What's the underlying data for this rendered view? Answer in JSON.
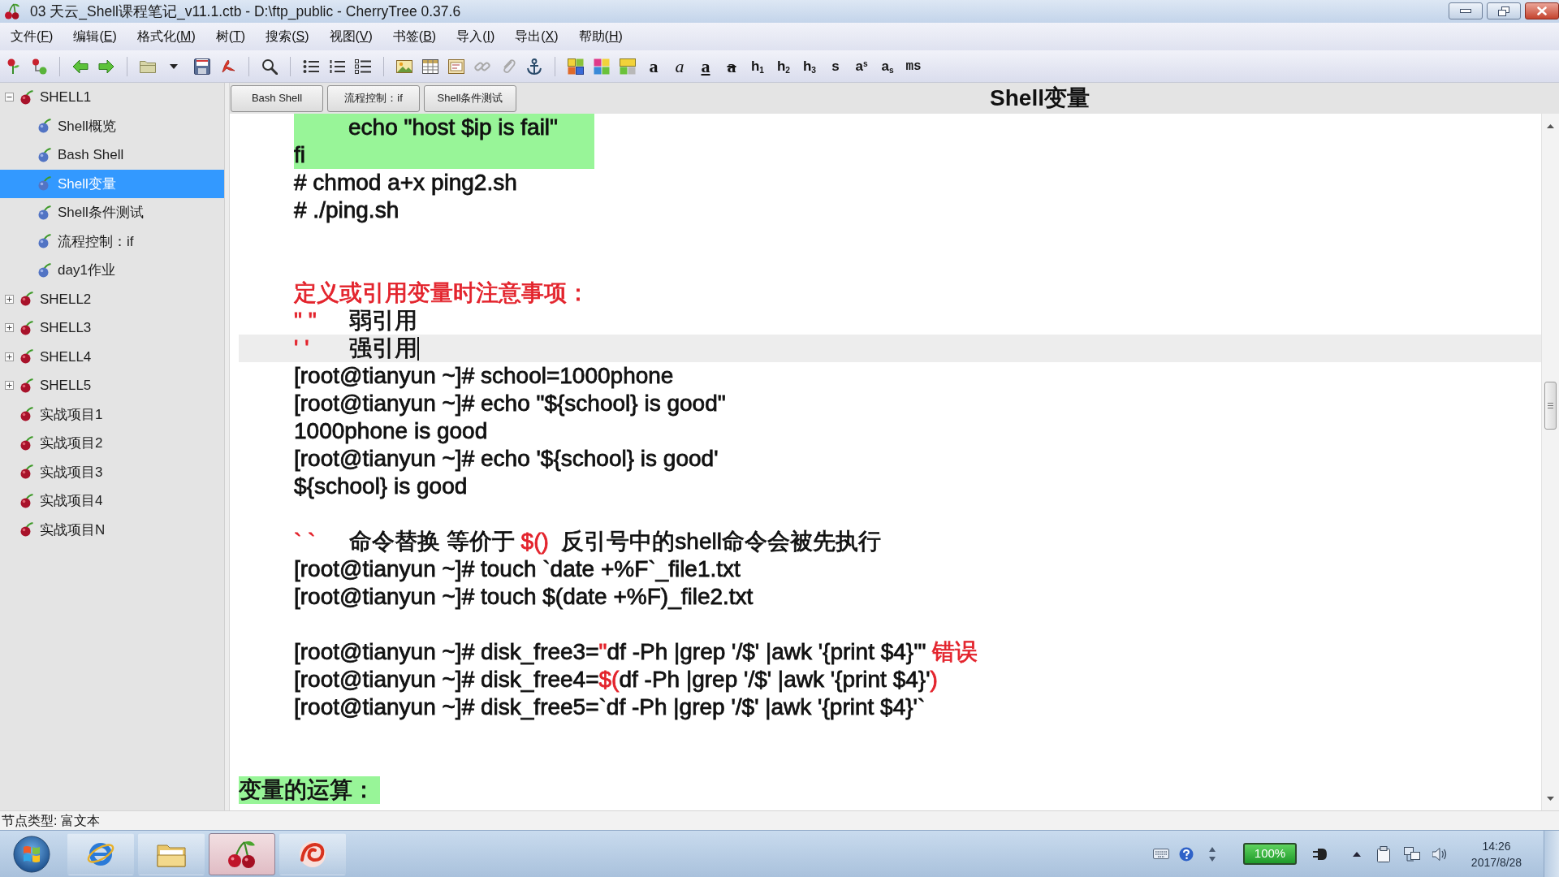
{
  "window": {
    "title": "03 天云_Shell课程笔记_v11.1.ctb - D:\\ftp_public - CherryTree 0.37.6"
  },
  "menu": [
    "文件(F)",
    "编辑(E)",
    "格式化(M)",
    "树(T)",
    "搜索(S)",
    "视图(V)",
    "书签(B)",
    "导入(I)",
    "导出(X)",
    "帮助(H)"
  ],
  "toolbar": {
    "format_buttons": [
      {
        "label": "a",
        "kind": "bold"
      },
      {
        "label": "a",
        "kind": "italic"
      },
      {
        "label": "a",
        "kind": "underline"
      },
      {
        "label": "a",
        "kind": "strike"
      },
      {
        "label": "h$_{1}$",
        "kind": "heading"
      },
      {
        "label": "h$_{2}$",
        "kind": "heading"
      },
      {
        "label": "h$_{3}$",
        "kind": "heading"
      },
      {
        "label": "s",
        "kind": "small"
      },
      {
        "label": "a$^{s}$",
        "kind": "raised"
      },
      {
        "label": "a$_{s}$",
        "kind": "lowered"
      },
      {
        "label": "ms",
        "kind": "mono"
      }
    ]
  },
  "tree": {
    "nodes": [
      {
        "label": "SHELL1",
        "expanded": true,
        "selected": false,
        "children": [
          {
            "label": "Shell概览",
            "selected": false
          },
          {
            "label": "Bash Shell",
            "selected": false
          },
          {
            "label": "Shell变量",
            "selected": true
          },
          {
            "label": "Shell条件测试",
            "selected": false
          },
          {
            "label": "流程控制：if",
            "selected": false
          },
          {
            "label": "day1作业",
            "selected": false
          }
        ]
      },
      {
        "label": "SHELL2",
        "expanded": false,
        "selected": false
      },
      {
        "label": "SHELL3",
        "expanded": false,
        "selected": false
      },
      {
        "label": "SHELL4",
        "expanded": false,
        "selected": false
      },
      {
        "label": "SHELL5",
        "expanded": false,
        "selected": false
      },
      {
        "label": "实战项目1",
        "selected": false
      },
      {
        "label": "实战项目2",
        "selected": false
      },
      {
        "label": "实战项目3",
        "selected": false
      },
      {
        "label": "实战项目4",
        "selected": false
      },
      {
        "label": "实战项目N",
        "selected": false
      }
    ]
  },
  "content": {
    "recent_nodes": [
      "Bash Shell",
      "流程控制：if",
      "Shell条件测试"
    ],
    "title": "Shell变量",
    "lines": [
      {
        "kind": "marked_inner",
        "current": false,
        "segments": [
          {
            "text": "echo \"host $ip is fail\"",
            "color": "#111111"
          }
        ]
      },
      {
        "kind": "marked",
        "current": false,
        "segments": [
          {
            "text": "fi",
            "color": "#111111"
          }
        ]
      },
      {
        "kind": "plain",
        "current": false,
        "segments": [
          {
            "text": "# chmod a+x ping2.sh",
            "color": "#111111"
          }
        ]
      },
      {
        "kind": "plain",
        "current": false,
        "segments": [
          {
            "text": "# ./ping.sh",
            "color": "#111111"
          }
        ]
      },
      {
        "kind": "blank"
      },
      {
        "kind": "blank"
      },
      {
        "kind": "plain",
        "current": false,
        "segments": [
          {
            "text": "定义或引用变量时注意事项：",
            "color": "#e3232c"
          }
        ]
      },
      {
        "kind": "pair",
        "current": false,
        "segments": [
          {
            "text": "\" \"",
            "color": "#e3232c"
          },
          {
            "text": "弱引用",
            "color": "#111111"
          }
        ]
      },
      {
        "kind": "pair",
        "current": true,
        "segments": [
          {
            "text": "' '",
            "color": "#e3232c"
          },
          {
            "text": "强引用",
            "color": "#111111"
          }
        ]
      },
      {
        "kind": "plain",
        "current": false,
        "segments": [
          {
            "text": "[root@tianyun ~]# school=1000phone",
            "color": "#111111"
          }
        ]
      },
      {
        "kind": "plain",
        "current": false,
        "segments": [
          {
            "text": "[root@tianyun ~]# echo \"${school} is good\"",
            "color": "#111111"
          }
        ]
      },
      {
        "kind": "plain",
        "current": false,
        "segments": [
          {
            "text": "1000phone is good",
            "color": "#111111"
          }
        ]
      },
      {
        "kind": "plain",
        "current": false,
        "segments": [
          {
            "text": "[root@tianyun ~]# echo '${school} is good'",
            "color": "#111111"
          }
        ]
      },
      {
        "kind": "plain",
        "current": false,
        "segments": [
          {
            "text": "${school} is good",
            "color": "#111111"
          }
        ]
      },
      {
        "kind": "blank"
      },
      {
        "kind": "pair",
        "current": false,
        "segments": [
          {
            "text": "` `",
            "color": "#e3232c"
          },
          {
            "text": "命令替换 等价于 ",
            "color": "#111111"
          },
          {
            "text": "$()",
            "color": "#e3232c"
          },
          {
            "text": "  反引号中的shell命令会被先执行",
            "color": "#111111"
          }
        ]
      },
      {
        "kind": "plain",
        "current": false,
        "segments": [
          {
            "text": "[root@tianyun ~]# touch `date +%F`_file1.txt",
            "color": "#111111"
          }
        ]
      },
      {
        "kind": "plain",
        "current": false,
        "segments": [
          {
            "text": "[root@tianyun ~]# touch $(date +%F)_file2.txt",
            "color": "#111111"
          }
        ]
      },
      {
        "kind": "blank"
      },
      {
        "kind": "plain",
        "current": false,
        "segments": [
          {
            "text": "[root@tianyun ~]# disk_free3=",
            "color": "#111111"
          },
          {
            "text": "\"",
            "color": "#e3232c"
          },
          {
            "text": "df -Ph |grep '/$' |awk '{print $4}'\" ",
            "color": "#111111"
          },
          {
            "text": "错误",
            "color": "#e3232c"
          }
        ]
      },
      {
        "kind": "plain",
        "current": false,
        "segments": [
          {
            "text": "[root@tianyun ~]# disk_free4=",
            "color": "#111111"
          },
          {
            "text": "$(",
            "color": "#e3232c"
          },
          {
            "text": "df -Ph |grep '/$' |awk '{print $4}'",
            "color": "#111111"
          },
          {
            "text": ")",
            "color": "#e3232c"
          }
        ]
      },
      {
        "kind": "plain",
        "current": false,
        "segments": [
          {
            "text": "[root@tianyun ~]# disk_free5=`df -Ph |grep '/$' |awk '{print $4}'`",
            "color": "#111111"
          }
        ]
      },
      {
        "kind": "blank"
      },
      {
        "kind": "blank"
      },
      {
        "kind": "heading",
        "current": false,
        "segments": [
          {
            "text": "变量的运算：",
            "color": "#111111"
          }
        ]
      }
    ]
  },
  "status_bar": {
    "text": "节点类型: 富文本"
  },
  "taskbar": {
    "apps": [
      {
        "kind": "browser",
        "selected": false
      },
      {
        "kind": "files",
        "selected": false
      },
      {
        "kind": "cherry",
        "selected": true
      },
      {
        "kind": "swirl",
        "selected": false
      }
    ],
    "tray": {
      "battery": "100%",
      "time": "14:26",
      "date": "2017/8/28"
    }
  }
}
